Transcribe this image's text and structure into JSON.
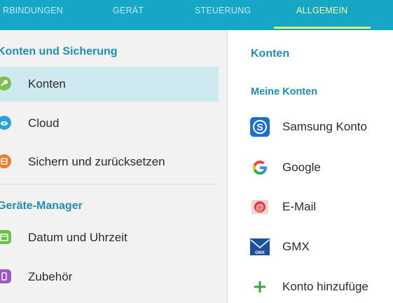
{
  "tabs": [
    {
      "label": "RBINDUNGEN"
    },
    {
      "label": "GERÄT"
    },
    {
      "label": "STEUERUNG"
    },
    {
      "label": "ALLGEMEIN",
      "active": true
    }
  ],
  "left": {
    "section1": "Konten und Sicherung",
    "items1": [
      {
        "label": "Konten",
        "icon": "key-icon",
        "selected": true
      },
      {
        "label": "Cloud",
        "icon": "cloud-icon"
      },
      {
        "label": "Sichern und zurücksetzen",
        "icon": "backup-icon"
      }
    ],
    "section2": "Geräte-Manager",
    "items2": [
      {
        "label": "Datum und Uhrzeit",
        "icon": "calendar-icon"
      },
      {
        "label": "Zubehör",
        "icon": "accessory-icon"
      }
    ],
    "section1_display": "Konten und Sicherung",
    "section2_display": "eräte-Manager"
  },
  "right": {
    "title": "Konten",
    "subtitle": "Meine Konten",
    "accounts": [
      {
        "label": "Samsung Konto",
        "icon": "samsung-icon"
      },
      {
        "label": "Google",
        "icon": "google-icon"
      },
      {
        "label": "E-Mail",
        "icon": "email-icon"
      },
      {
        "label": "GMX",
        "icon": "gmx-icon"
      },
      {
        "label": "Konto hinzufüge",
        "icon": "plus-icon"
      }
    ]
  },
  "colors": {
    "tabbar": "#16a7c6",
    "accent_text": "#1f8fb0",
    "selected_row": "#cfe9f0",
    "active_tab": "#f4f6a8"
  }
}
